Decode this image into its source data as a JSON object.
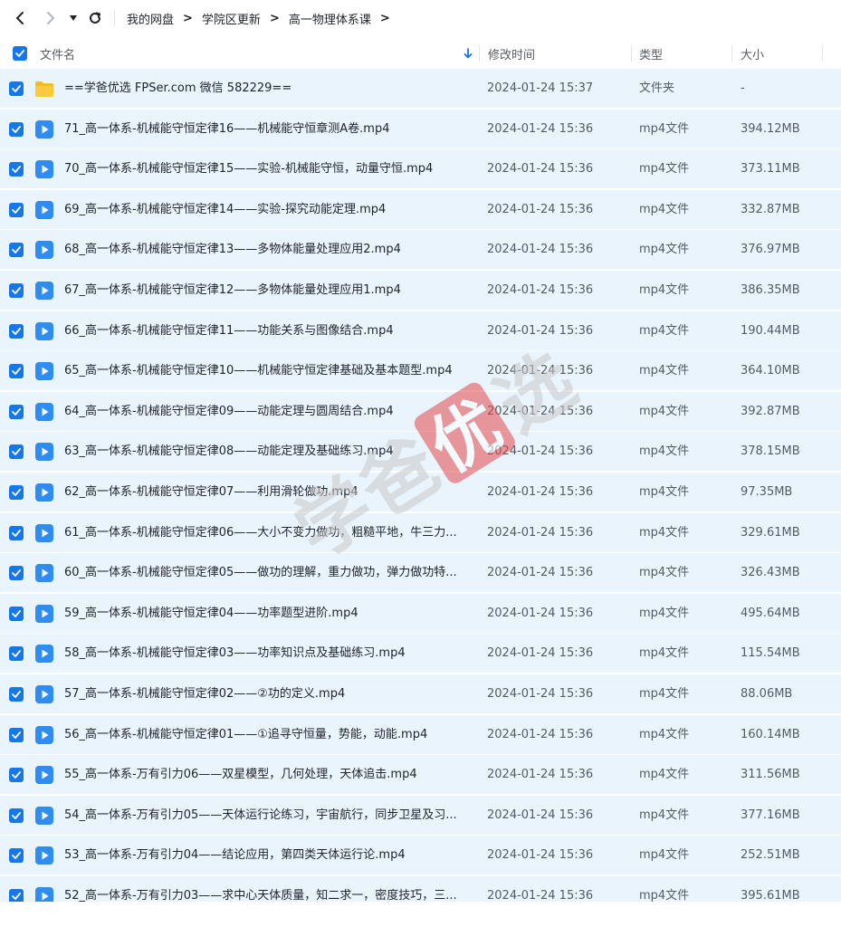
{
  "breadcrumb": {
    "items": [
      "我的网盘",
      "学院区更新",
      "高一物理体系课"
    ],
    "separator": ">"
  },
  "table": {
    "headers": {
      "name": "文件名",
      "modified": "修改时间",
      "type": "类型",
      "size": "大小"
    },
    "rows": [
      {
        "kind": "folder",
        "name": "==学爸优选 FPSer.com 微信 582229==",
        "modified": "2024-01-24 15:37",
        "type": "文件夹",
        "size": "-"
      },
      {
        "kind": "video",
        "name": "71_高一体系-机械能守恒定律16——机械能守恒章测A卷.mp4",
        "modified": "2024-01-24 15:36",
        "type": "mp4文件",
        "size": "394.12MB"
      },
      {
        "kind": "video",
        "name": "70_高一体系-机械能守恒定律15——实验-机械能守恒，动量守恒.mp4",
        "modified": "2024-01-24 15:36",
        "type": "mp4文件",
        "size": "373.11MB"
      },
      {
        "kind": "video",
        "name": "69_高一体系-机械能守恒定律14——实验-探究动能定理.mp4",
        "modified": "2024-01-24 15:36",
        "type": "mp4文件",
        "size": "332.87MB"
      },
      {
        "kind": "video",
        "name": "68_高一体系-机械能守恒定律13——多物体能量处理应用2.mp4",
        "modified": "2024-01-24 15:36",
        "type": "mp4文件",
        "size": "376.97MB"
      },
      {
        "kind": "video",
        "name": "67_高一体系-机械能守恒定律12——多物体能量处理应用1.mp4",
        "modified": "2024-01-24 15:36",
        "type": "mp4文件",
        "size": "386.35MB"
      },
      {
        "kind": "video",
        "name": "66_高一体系-机械能守恒定律11——功能关系与图像结合.mp4",
        "modified": "2024-01-24 15:36",
        "type": "mp4文件",
        "size": "190.44MB"
      },
      {
        "kind": "video",
        "name": "65_高一体系-机械能守恒定律10——机械能守恒定律基础及基本题型.mp4",
        "modified": "2024-01-24 15:36",
        "type": "mp4文件",
        "size": "364.10MB"
      },
      {
        "kind": "video",
        "name": "64_高一体系-机械能守恒定律09——动能定理与圆周结合.mp4",
        "modified": "2024-01-24 15:36",
        "type": "mp4文件",
        "size": "392.87MB"
      },
      {
        "kind": "video",
        "name": "63_高一体系-机械能守恒定律08——动能定理及基础练习.mp4",
        "modified": "2024-01-24 15:36",
        "type": "mp4文件",
        "size": "378.15MB"
      },
      {
        "kind": "video",
        "name": "62_高一体系-机械能守恒定律07——利用滑轮做功.mp4",
        "modified": "2024-01-24 15:36",
        "type": "mp4文件",
        "size": "97.35MB"
      },
      {
        "kind": "video",
        "name": "61_高一体系-机械能守恒定律06——大小不变力做功，粗糙平地，牛三力...",
        "modified": "2024-01-24 15:36",
        "type": "mp4文件",
        "size": "329.61MB"
      },
      {
        "kind": "video",
        "name": "60_高一体系-机械能守恒定律05——做功的理解，重力做功，弹力做功特...",
        "modified": "2024-01-24 15:36",
        "type": "mp4文件",
        "size": "326.43MB"
      },
      {
        "kind": "video",
        "name": "59_高一体系-机械能守恒定律04——功率题型进阶.mp4",
        "modified": "2024-01-24 15:36",
        "type": "mp4文件",
        "size": "495.64MB"
      },
      {
        "kind": "video",
        "name": "58_高一体系-机械能守恒定律03——功率知识点及基础练习.mp4",
        "modified": "2024-01-24 15:36",
        "type": "mp4文件",
        "size": "115.54MB"
      },
      {
        "kind": "video",
        "name": "57_高一体系-机械能守恒定律02——②功的定义.mp4",
        "modified": "2024-01-24 15:36",
        "type": "mp4文件",
        "size": "88.06MB"
      },
      {
        "kind": "video",
        "name": "56_高一体系-机械能守恒定律01——①追寻守恒量，势能，动能.mp4",
        "modified": "2024-01-24 15:36",
        "type": "mp4文件",
        "size": "160.14MB"
      },
      {
        "kind": "video",
        "name": "55_高一体系-万有引力06——双星模型，几何处理，天体追击.mp4",
        "modified": "2024-01-24 15:36",
        "type": "mp4文件",
        "size": "311.56MB"
      },
      {
        "kind": "video",
        "name": "54_高一体系-万有引力05——天体运行论练习，宇宙航行，同步卫星及习...",
        "modified": "2024-01-24 15:36",
        "type": "mp4文件",
        "size": "377.16MB"
      },
      {
        "kind": "video",
        "name": "53_高一体系-万有引力04——结论应用，第四类天体运行论.mp4",
        "modified": "2024-01-24 15:36",
        "type": "mp4文件",
        "size": "252.51MB"
      },
      {
        "kind": "video",
        "name": "52_高一体系-万有引力03——求中心天体质量，知二求一，密度技巧，三...",
        "modified": "2024-01-24 15:36",
        "type": "mp4文件",
        "size": "395.61MB"
      }
    ]
  },
  "watermark": {
    "text": "学爸优选"
  },
  "colors": {
    "accent": "#1677e8",
    "row_selected": "#eaf4fd",
    "folder": "#f7b928",
    "video": "#2f8cf0",
    "watermark": "#d94545"
  }
}
